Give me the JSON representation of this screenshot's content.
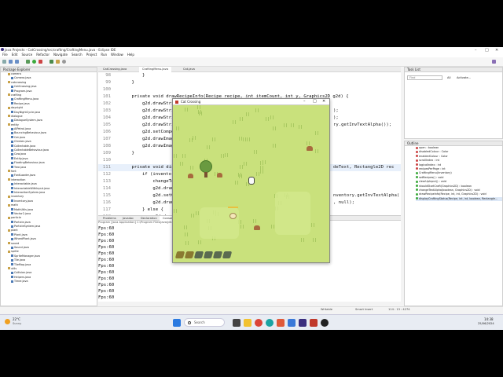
{
  "window": {
    "title": "Java Projects - CatCrossing/src/crafting/CraftingMenu.java - Eclipse IDE"
  },
  "menubar": [
    "File",
    "Edit",
    "Source",
    "Refactor",
    "Navigate",
    "Search",
    "Project",
    "Run",
    "Window",
    "Help"
  ],
  "package_explorer": {
    "title": "Package Explorer",
    "items": [
      "camera",
      "Camera.java",
      "catcrossing",
      "CatCrossing.java",
      "Program.java",
      "crafting",
      "CraftingMenu.java",
      "Recipe.java",
      "daynight",
      "DayNightCycle.java",
      "dialogue",
      "DialogueSystem.java",
      "entity",
      "AIPetrol.java",
      "BouncingBehaviour.java",
      "Cat.java",
      "Chicken.java",
      "Collectable.java",
      "CollectableBehaviour.java",
      "Cow.java",
      "Entity.java",
      "FloatingBehaviour.java",
      "Tree.java",
      "font",
      "FontLoader.java",
      "interaction",
      "Interactable.java",
      "InteractableWithInput.java",
      "InteractionSystem.java",
      "inventory",
      "Inventory.java",
      "math",
      "MathUtils.java",
      "Vector2.java",
      "particle",
      "Particle.java",
      "ParticleSystem.java",
      "plant",
      "Plant.java",
      "WheatPlant.java",
      "sound",
      "Sound.java",
      "sprite",
      "SpriteManager.java",
      "Tile.java",
      "TileMap.java",
      "utils",
      "Collision.java",
      "Helpers.java",
      "Timer.java"
    ]
  },
  "editor": {
    "tabs": [
      "CatCrossing.java",
      "CraftingMenu.java",
      "Cat.java"
    ],
    "lines": [
      {
        "n": "98",
        "code": "        }"
      },
      {
        "n": "99",
        "code": "    }"
      },
      {
        "n": "100",
        "code": ""
      },
      {
        "n": "101",
        "code": "    private void drawRecipeInfo(Recipe recipe, int itemCount, int y, Graphics2D g2d) {"
      },
      {
        "n": "102",
        "code": "        g2d.drawString(r"
      },
      {
        "n": "103",
        "code": "        g2d.drawString(I"
      },
      {
        "n": "104",
        "code": "        g2d.drawString(\""
      },
      {
        "n": "105",
        "code": "        g2d.drawString(\""
      },
      {
        "n": "106",
        "code": "        g2d.setComposite"
      },
      {
        "n": "107",
        "code": "        g2d.drawImage(r"
      },
      {
        "n": "108",
        "code": "        g2d.drawImage(r"
      },
      {
        "n": "109",
        "code": "    }"
      },
      {
        "n": "110",
        "code": ""
      },
      {
        "n": "111",
        "code": "    private void display"
      },
      {
        "n": "112",
        "code": "        if (inventory.h"
      },
      {
        "n": "113",
        "code": "            changeTextA"
      },
      {
        "n": "114",
        "code": "            g2d.drawStr"
      },
      {
        "n": "115",
        "code": "            g2d.setCompo"
      },
      {
        "n": "116",
        "code": "            g2d.drawImag"
      },
      {
        "n": "117",
        "code": "        } else {"
      },
      {
        "n": "118",
        "code": "            g2d.drawImag"
      },
      {
        "n": "119",
        "code": "        }"
      },
      {
        "n": "120",
        "code": "    }"
      }
    ],
    "right_fragments": [
      {
        "row": 5,
        "text": ");"
      },
      {
        "row": 6,
        "text": ");"
      },
      {
        "row": 7,
        "text": "ry.getInvTextAlpha());"
      },
      {
        "row": 13,
        "text": "deText, Rectangle2D rec"
      },
      {
        "row": 17,
        "text": "nventory.getInvTextAlpha("
      },
      {
        "row": 18,
        "text": ", null);"
      },
      {
        "row": 21,
        "text": "S, null);"
      }
    ]
  },
  "game_window": {
    "title": "Cat Crossing",
    "hotbar_count": 6
  },
  "console": {
    "tabs": [
      "Problems",
      "Javadoc",
      "Declaration",
      "Console"
    ],
    "header": "Program [Java Application] C:\\Program Files\\Java\\jdk...",
    "lines": [
      "Fps:60",
      "Fps:60",
      "Fps:60",
      "Fps:60",
      "Fps:60",
      "Fps:60",
      "Fps:60",
      "Fps:60",
      "Fps:60",
      "Fps:60",
      "Fps:60",
      "Fps:60"
    ]
  },
  "task_list": {
    "title": "Task List",
    "find_placeholder": "Find",
    "all": "All",
    "activate": "Activate..."
  },
  "outline": {
    "title": "Outline",
    "items": [
      "open : boolean",
      "disabledColour : Color",
      "enabledColour : Color",
      "scrollIndex : int",
      "logicalIndex : int",
      "recipesPerPage : int",
      "CraftingMenu(Inventory)",
      "setRecipes() : void",
      "clearUpInput() : void",
      "shouldStartCraft(Graphics2D) : boolean",
      "changeTextAlpha(boolean, Graphics2D) : void",
      "drawRecipeInfo(Recipe, int, int, Graphics2D) : void",
      "displayCraftingStatus(Recipe, int, int, boolean, Rectangle..."
    ]
  },
  "statusbar": {
    "writable": "Writable",
    "insert": "Smart Insert",
    "position": "114 : 13 : 4274"
  },
  "taskbar": {
    "weather_temp": "22°C",
    "weather_desc": "Sunny",
    "search_placeholder": "Search",
    "time": "14:38",
    "date": "25/06/2024"
  }
}
